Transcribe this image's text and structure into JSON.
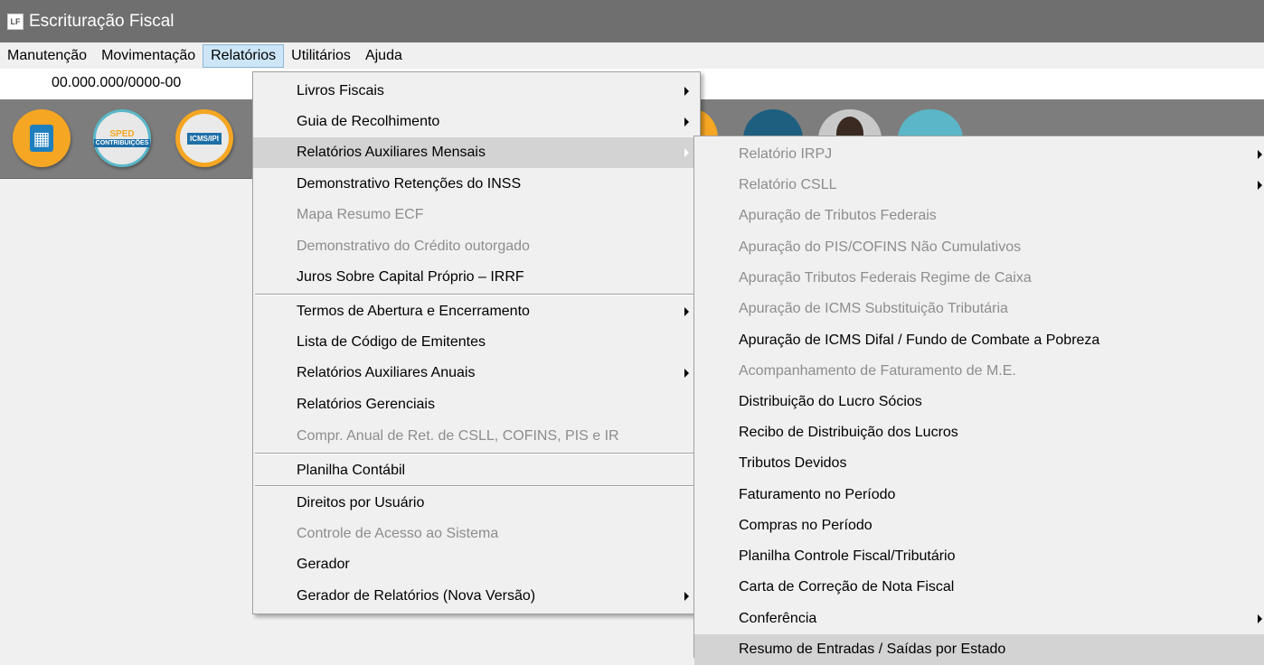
{
  "window": {
    "logo": "LF",
    "title": "Escrituração Fiscal"
  },
  "menubar": {
    "items": [
      "Manutenção",
      "Movimentação",
      "Relatórios",
      "Utilitários",
      "Ajuda"
    ]
  },
  "company": {
    "cnpj": "00.000.000/0000-00"
  },
  "toolbar": {
    "building_icon": "building-icon",
    "sped_top": "SPED",
    "sped_bottom": "CONTRIBUIÇÕES",
    "icms_label": "ICMS/IPI"
  },
  "relatorios_menu": {
    "items": [
      {
        "label": "Livros Fiscais",
        "enabled": true,
        "submenu": true
      },
      {
        "label": "Guia de Recolhimento",
        "enabled": true,
        "submenu": true
      },
      {
        "label": "Relatórios Auxiliares Mensais",
        "enabled": true,
        "submenu": true,
        "highlighted": true
      },
      {
        "label": "Demonstrativo Retenções do INSS",
        "enabled": true
      },
      {
        "label": "Mapa Resumo ECF",
        "enabled": false
      },
      {
        "label": "Demonstrativo do Crédito outorgado",
        "enabled": false
      },
      {
        "label": "Juros Sobre Capital Próprio – IRRF",
        "enabled": true
      },
      {
        "label": "Termos de Abertura e Encerramento",
        "enabled": true,
        "submenu": true
      },
      {
        "label": "Lista de Código de Emitentes",
        "enabled": true
      },
      {
        "label": "Relatórios Auxiliares Anuais",
        "enabled": true,
        "submenu": true
      },
      {
        "label": "Relatórios Gerenciais",
        "enabled": true
      },
      {
        "label": "Compr. Anual de Ret. de CSLL, COFINS,  PIS e IR",
        "enabled": false
      },
      {
        "label": "Planilha Contábil",
        "enabled": true
      },
      {
        "label": "Direitos por Usuário",
        "enabled": true
      },
      {
        "label": "Controle de Acesso ao Sistema",
        "enabled": false
      },
      {
        "label": "Gerador",
        "enabled": true
      },
      {
        "label": "Gerador de Relatórios (Nova Versão)",
        "enabled": true,
        "submenu": true
      }
    ]
  },
  "mensais_submenu": {
    "items": [
      {
        "label": "Relatório IRPJ",
        "enabled": false,
        "submenu": true
      },
      {
        "label": "Relatório CSLL",
        "enabled": false,
        "submenu": true
      },
      {
        "label": "Apuração de Tributos Federais",
        "enabled": false
      },
      {
        "label": "Apuração do PIS/COFINS Não Cumulativos",
        "enabled": false
      },
      {
        "label": "Apuração Tributos Federais Regime de Caixa",
        "enabled": false
      },
      {
        "label": "Apuração de ICMS Substituição Tributária",
        "enabled": false
      },
      {
        "label": "Apuração de ICMS Difal / Fundo de Combate a Pobreza",
        "enabled": true
      },
      {
        "label": "Acompanhamento de Faturamento de M.E.",
        "enabled": false
      },
      {
        "label": "Distribuição do Lucro Sócios",
        "enabled": true
      },
      {
        "label": "Recibo de Distribuição dos Lucros",
        "enabled": true
      },
      {
        "label": "Tributos Devidos",
        "enabled": true
      },
      {
        "label": "Faturamento no Período",
        "enabled": true
      },
      {
        "label": "Compras no Período",
        "enabled": true
      },
      {
        "label": "Planilha Controle Fiscal/Tributário",
        "enabled": true
      },
      {
        "label": "Carta de Correção de Nota Fiscal",
        "enabled": true
      },
      {
        "label": "Conferência",
        "enabled": true,
        "submenu": true
      },
      {
        "label": "Resumo de Entradas / Saídas por Estado",
        "enabled": true,
        "highlighted": true
      }
    ]
  }
}
